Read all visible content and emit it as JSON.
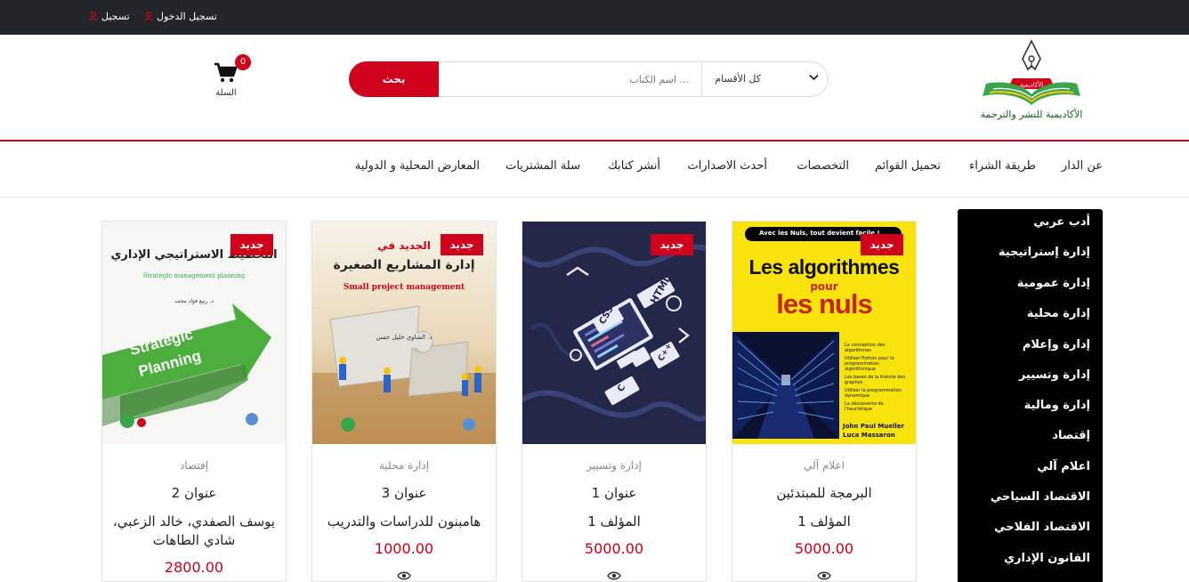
{
  "topbar": {
    "login_label": "تسجيل الدخول",
    "register_label": "تسجيل"
  },
  "header": {
    "cart_count": "0",
    "cart_label": "السلة",
    "search_button": "بحث",
    "search_placeholder": "اسم الكتاب ...",
    "category_select": "كل الأقسام",
    "logo_badge": "الأكاديمية",
    "logo_text": "الأكاديمية للنشر والترجمة"
  },
  "nav": {
    "items": [
      "عن الدار",
      "طريقة الشراء",
      "تحميل القوائم",
      "التخصصات",
      "أحدث الاصدارات",
      "أنشر كتابك",
      "سلة المشتريات",
      "المعارض المحلية و الدولية"
    ]
  },
  "sidebar": {
    "items": [
      "أدب عربي",
      "إدارة إستراتيجية",
      "إدارة عمومية",
      "إدارة محلية",
      "إدارة وإعلام",
      "إدارة وتسيير",
      "إدارة ومالية",
      "إقتصاد",
      "اعلام آلي",
      "الاقتصاد السياحي",
      "الاقتصاد الفلاحي",
      "القانون الإداري"
    ]
  },
  "products": [
    {
      "badge": "جديد",
      "category": "اعلام آلي",
      "title": "البرمجة للمبتدئين",
      "author": "المؤلف 1",
      "price": "5000.00",
      "cover": {
        "top_banner": "Avec les Nuls, tout devient facile !",
        "heading": "Les algorithmes",
        "pour": "pour",
        "nuls": "les nuls",
        "bullets": [
          "La conception des algorithmes",
          "Utiliser Python pour la programmation algorithmique",
          "Les bases de la théorie des graphes",
          "Utiliser la programmation dynamique",
          "La découverte de l'heuristique"
        ],
        "authors": [
          "John Paul Mueller",
          "Luca Massaron"
        ]
      }
    },
    {
      "badge": "جديد",
      "category": "إدارة وتسيير",
      "title": "عنوان 1",
      "author": "المؤلف 1",
      "price": "5000.00",
      "cover": {
        "html": "HTML",
        "css": "CSS",
        "cpp": "C++",
        "cc": "C"
      }
    },
    {
      "badge": "جديد",
      "category": "إدارة محلية",
      "title": "عنوان 3",
      "author": "هامبنون للدراسات والتدريب",
      "price": "1000.00",
      "cover": {
        "kicker": "الجديد في",
        "heading": "إدارة المشاريع الصغيرة",
        "english": "Small project management",
        "author": "د. الشاوي خليل حسن"
      }
    },
    {
      "badge": "جديد",
      "category": "إقتصاد",
      "title": "عنوان 2",
      "author": "يوسف الصفدي، خالد الزعبي، شادي الطاهات",
      "price": "2800.00",
      "cover": {
        "heading": "التخطيط الاستراتيجي الإداري",
        "english": "Strategic management planning",
        "author": "د. ربيع فؤاد محمد",
        "arrow1": "Strategic",
        "arrow2": "Planning"
      }
    }
  ],
  "colors": {
    "brand_red": "#d0021b",
    "topbar_bg": "#22252a",
    "sidebar_bg": "#000000",
    "price_red": "#c4001a"
  },
  "icons": [
    "user-icon",
    "cart-icon",
    "chevron-down-icon",
    "eye-icon",
    "pen-nib-icon",
    "open-book-icon"
  ]
}
